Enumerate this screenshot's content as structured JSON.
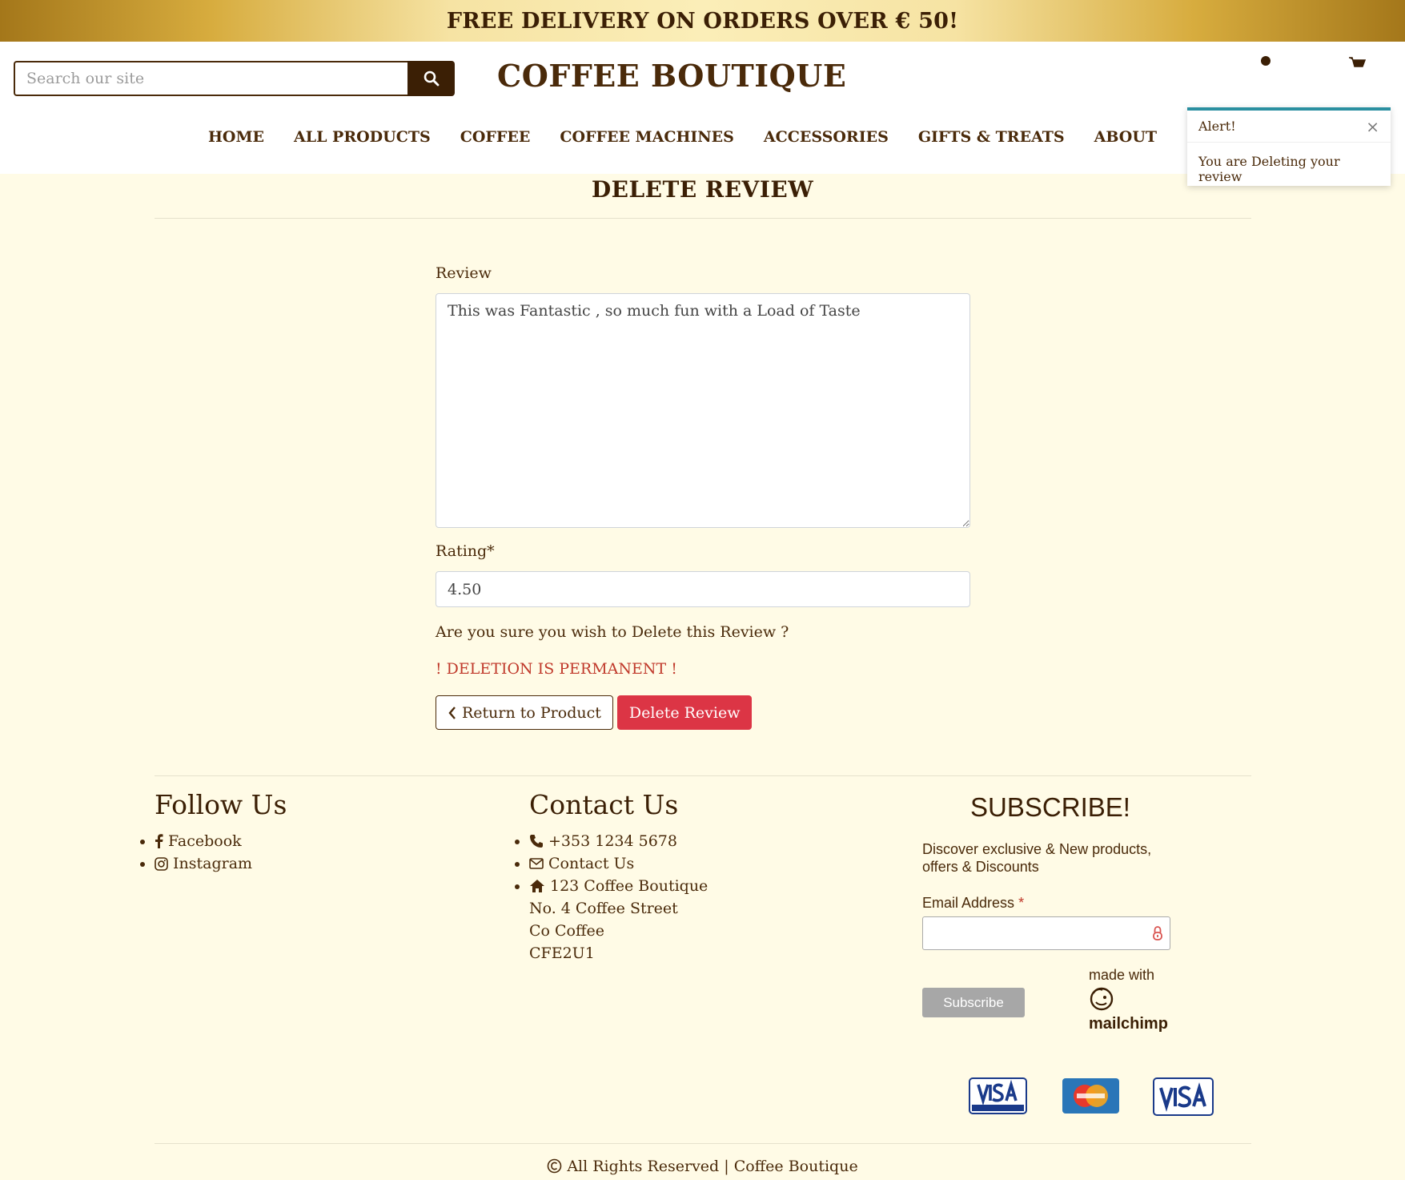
{
  "banner": {
    "text": "FREE DELIVERY ON ORDERS OVER € 50!"
  },
  "header": {
    "search_placeholder": "Search our site",
    "brand": "COFFEE BOUTIQUE",
    "nav": [
      "HOME",
      "ALL PRODUCTS",
      "COFFEE",
      "COFFEE MACHINES",
      "ACCESSORIES",
      "GIFTS & TREATS",
      "ABOUT"
    ]
  },
  "toast": {
    "title": "Alert!",
    "close": "×",
    "message": "You are Deleting your review",
    "accent": "#2a8fa0"
  },
  "page": {
    "title": "DELETE REVIEW"
  },
  "form": {
    "review_label": "Review",
    "review_value": "This was Fantastic , so much fun with a Load of Taste",
    "rating_label": "Rating*",
    "rating_value": "4.50",
    "confirm_text": "Are you sure you wish to Delete this Review ?",
    "warning_text": "! DELETION IS PERMANENT !",
    "return_label": "Return to Product",
    "delete_label": "Delete Review"
  },
  "footer": {
    "follow": {
      "title": "Follow Us",
      "items": [
        "Facebook",
        "Instagram"
      ]
    },
    "contact": {
      "title": "Contact Us",
      "phone": "+353 1234 5678",
      "contact_link": "Contact Us",
      "address_line1": "123 Coffee Boutique",
      "address_extra": [
        "No. 4 Coffee Street",
        "Co Coffee",
        "CFE2U1"
      ]
    },
    "subscribe": {
      "title": "SUBSCRIBE!",
      "description": "Discover exclusive & New products, offers & Discounts",
      "email_label": "Email Address",
      "required_mark": "*",
      "button": "Subscribe",
      "made_with": "made with",
      "mailchimp": "mailchimp"
    },
    "payment_icons": [
      "visa-electron-icon",
      "mastercard-icon",
      "visa-icon"
    ],
    "copyright": "All Rights Reserved | Coffee Boutique"
  },
  "colors": {
    "brand_brown": "#4a2a0a",
    "danger": "#dc3545",
    "background": "#fffbe6"
  }
}
